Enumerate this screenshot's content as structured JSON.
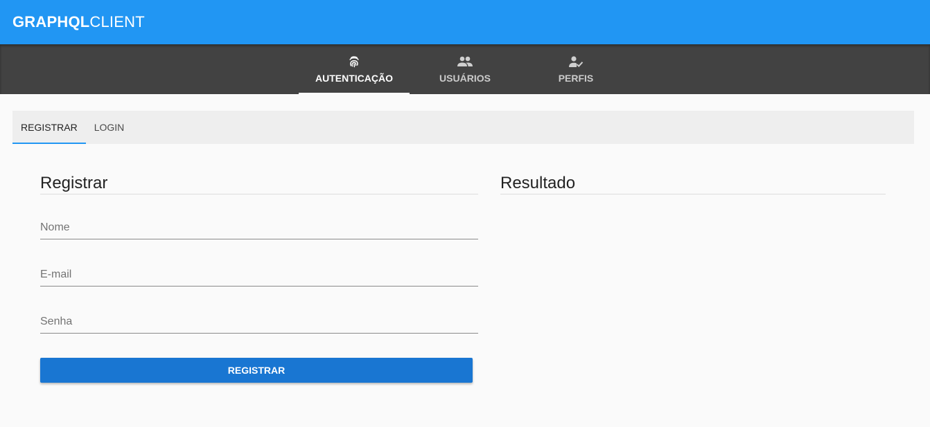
{
  "app": {
    "brand_bold": "GRAPHQL",
    "brand_light": "CLIENT"
  },
  "main_tabs": [
    {
      "label": "AUTENTICAÇÃO",
      "icon": "fingerprint-icon",
      "active": true
    },
    {
      "label": "USUÁRIOS",
      "icon": "people-icon",
      "active": false
    },
    {
      "label": "PERFIS",
      "icon": "person-check-icon",
      "active": false
    }
  ],
  "sub_tabs": [
    {
      "label": "REGISTRAR",
      "active": true
    },
    {
      "label": "LOGIN",
      "active": false
    }
  ],
  "form": {
    "title": "Registrar",
    "fields": [
      {
        "placeholder": "Nome",
        "value": ""
      },
      {
        "placeholder": "E-mail",
        "value": ""
      },
      {
        "placeholder": "Senha",
        "value": ""
      }
    ],
    "submit_label": "REGISTRAR"
  },
  "result": {
    "title": "Resultado"
  },
  "colors": {
    "app_bar": "#2196f3",
    "tab_bar": "#424242",
    "primary_button": "#1976d2"
  }
}
